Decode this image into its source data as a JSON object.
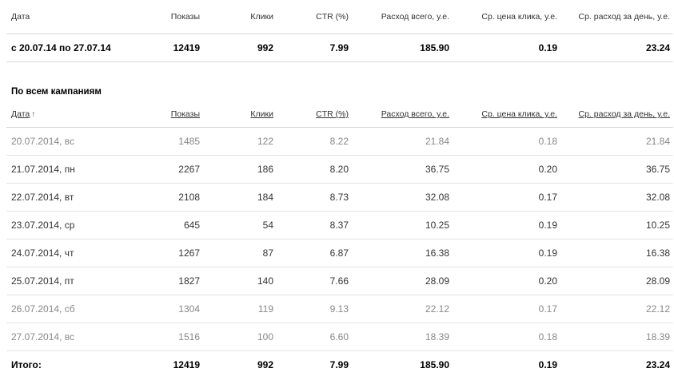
{
  "summary": {
    "headers": [
      "Дата",
      "Показы",
      "Клики",
      "CTR (%)",
      "Расход всего, у.е.",
      "Ср. цена клика, у.е.",
      "Ср. расход за день, у.е."
    ],
    "row": {
      "period": "с 20.07.14 по 27.07.14",
      "shows": "12419",
      "clicks": "992",
      "ctr": "7.99",
      "spend": "185.90",
      "cpc": "0.19",
      "daily": "23.24"
    }
  },
  "campaigns": {
    "title": "По всем кампаниям",
    "headers": [
      "Дата",
      "Показы",
      "Клики",
      "CTR (%)",
      "Расход всего, у.е.",
      "Ср. цена клика, у.е.",
      "Ср. расход за день, у.е."
    ],
    "sort_indicator": "↑",
    "rows": [
      {
        "date": "20.07.2014, вс",
        "shows": "1485",
        "clicks": "122",
        "ctr": "8.22",
        "spend": "21.84",
        "cpc": "0.18",
        "daily": "21.84",
        "weekend": true
      },
      {
        "date": "21.07.2014, пн",
        "shows": "2267",
        "clicks": "186",
        "ctr": "8.20",
        "spend": "36.75",
        "cpc": "0.20",
        "daily": "36.75",
        "weekend": false
      },
      {
        "date": "22.07.2014, вт",
        "shows": "2108",
        "clicks": "184",
        "ctr": "8.73",
        "spend": "32.08",
        "cpc": "0.17",
        "daily": "32.08",
        "weekend": false
      },
      {
        "date": "23.07.2014, ср",
        "shows": "645",
        "clicks": "54",
        "ctr": "8.37",
        "spend": "10.25",
        "cpc": "0.19",
        "daily": "10.25",
        "weekend": false
      },
      {
        "date": "24.07.2014, чт",
        "shows": "1267",
        "clicks": "87",
        "ctr": "6.87",
        "spend": "16.38",
        "cpc": "0.19",
        "daily": "16.38",
        "weekend": false
      },
      {
        "date": "25.07.2014, пт",
        "shows": "1827",
        "clicks": "140",
        "ctr": "7.66",
        "spend": "28.09",
        "cpc": "0.20",
        "daily": "28.09",
        "weekend": false
      },
      {
        "date": "26.07.2014, сб",
        "shows": "1304",
        "clicks": "119",
        "ctr": "9.13",
        "spend": "22.12",
        "cpc": "0.17",
        "daily": "22.12",
        "weekend": true
      },
      {
        "date": "27.07.2014, вс",
        "shows": "1516",
        "clicks": "100",
        "ctr": "6.60",
        "spend": "18.39",
        "cpc": "0.18",
        "daily": "18.39",
        "weekend": true
      }
    ],
    "total": {
      "label": "Итого:",
      "shows": "12419",
      "clicks": "992",
      "ctr": "7.99",
      "spend": "185.90",
      "cpc": "0.19",
      "daily": "23.24"
    }
  }
}
